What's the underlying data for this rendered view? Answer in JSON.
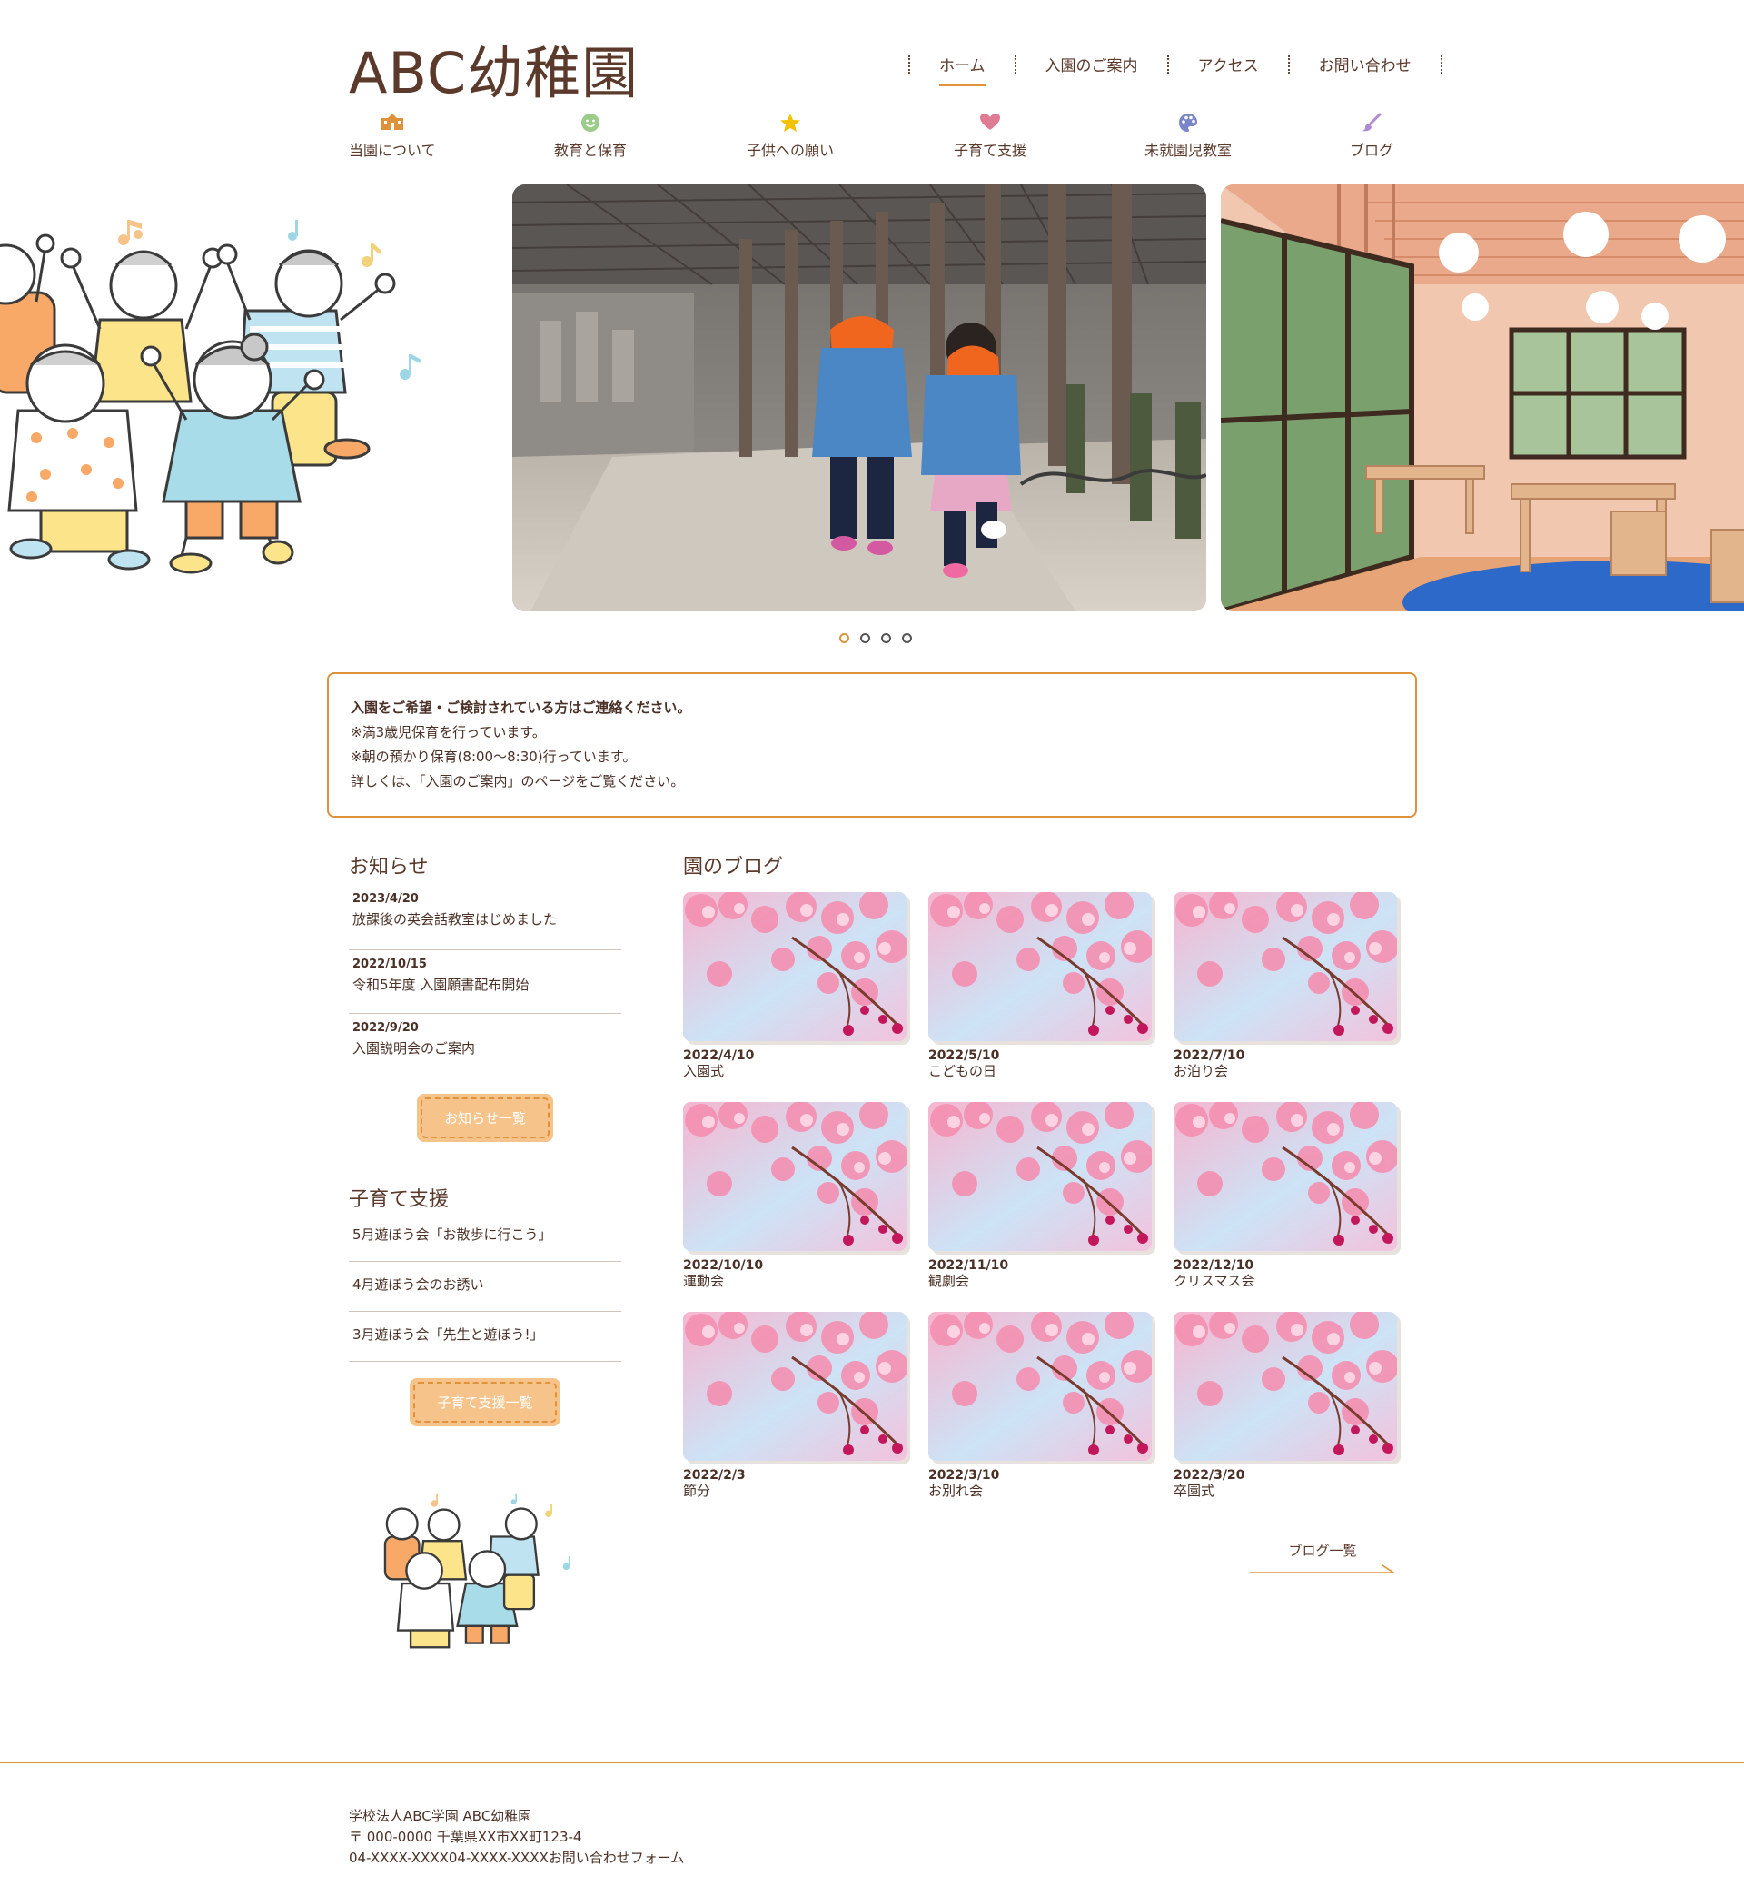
{
  "site": {
    "title": "ABC幼稚園"
  },
  "top_nav": [
    {
      "label": "ホーム",
      "active": true
    },
    {
      "label": "入園のご案内"
    },
    {
      "label": "アクセス"
    },
    {
      "label": "お問い合わせ"
    }
  ],
  "icon_nav": [
    {
      "label": "当園について",
      "icon": "school-icon",
      "color": "#e0923a"
    },
    {
      "label": "教育と保育",
      "icon": "smile-icon",
      "color": "#9ccc8a"
    },
    {
      "label": "子供への願い",
      "icon": "star-icon",
      "color": "#f2c200"
    },
    {
      "label": "子育て支援",
      "icon": "heart-icon",
      "color": "#e07b96"
    },
    {
      "label": "未就園児教室",
      "icon": "palette-icon",
      "color": "#7b86c8"
    },
    {
      "label": "ブログ",
      "icon": "brush-icon",
      "color": "#b18ad0"
    }
  ],
  "slider": {
    "dots": 4,
    "active_index": 0
  },
  "notice": {
    "lead": "入園をご希望・ご検討されている方はご連絡ください。",
    "lines": [
      "※満3歳児保育を行っています。",
      "※朝の預かり保育(8:00〜8:30)行っています。",
      "詳しくは、「入園のご案内」のページをご覧ください。"
    ]
  },
  "news": {
    "title": "お知らせ",
    "items": [
      {
        "date": "2023/4/20",
        "title": "放課後の英会話教室はじめました"
      },
      {
        "date": "2022/10/15",
        "title": "令和5年度 入園願書配布開始"
      },
      {
        "date": "2022/9/20",
        "title": "入園説明会のご案内"
      }
    ],
    "button": "お知らせ一覧"
  },
  "support": {
    "title": "子育て支援",
    "items": [
      "5月遊ぼう会「お散歩に行こう」",
      "4月遊ぼう会のお誘い",
      "3月遊ぼう会「先生と遊ぼう!」"
    ],
    "button": "子育て支援一覧"
  },
  "blog": {
    "title": "園のブログ",
    "posts": [
      {
        "date": "2022/4/10",
        "title": "入園式"
      },
      {
        "date": "2022/5/10",
        "title": "こどもの日"
      },
      {
        "date": "2022/7/10",
        "title": "お泊り会"
      },
      {
        "date": "2022/10/10",
        "title": "運動会"
      },
      {
        "date": "2022/11/10",
        "title": "観劇会"
      },
      {
        "date": "2022/12/10",
        "title": "クリスマス会"
      },
      {
        "date": "2022/2/3",
        "title": "節分"
      },
      {
        "date": "2022/3/10",
        "title": "お別れ会"
      },
      {
        "date": "2022/3/20",
        "title": "卒園式"
      }
    ],
    "more": "ブログ一覧"
  },
  "footer": {
    "org": "学校法人ABC学園 ABC幼稚園",
    "address": "〒 000-0000 千葉県XX市XX町123-4",
    "contact": "04-XXXX-XXXX04-XXXX-XXXXお問い合わせフォーム"
  },
  "colors": {
    "accent": "#e0923a",
    "text": "#4a3026",
    "button_fill": "#f6c48a"
  }
}
